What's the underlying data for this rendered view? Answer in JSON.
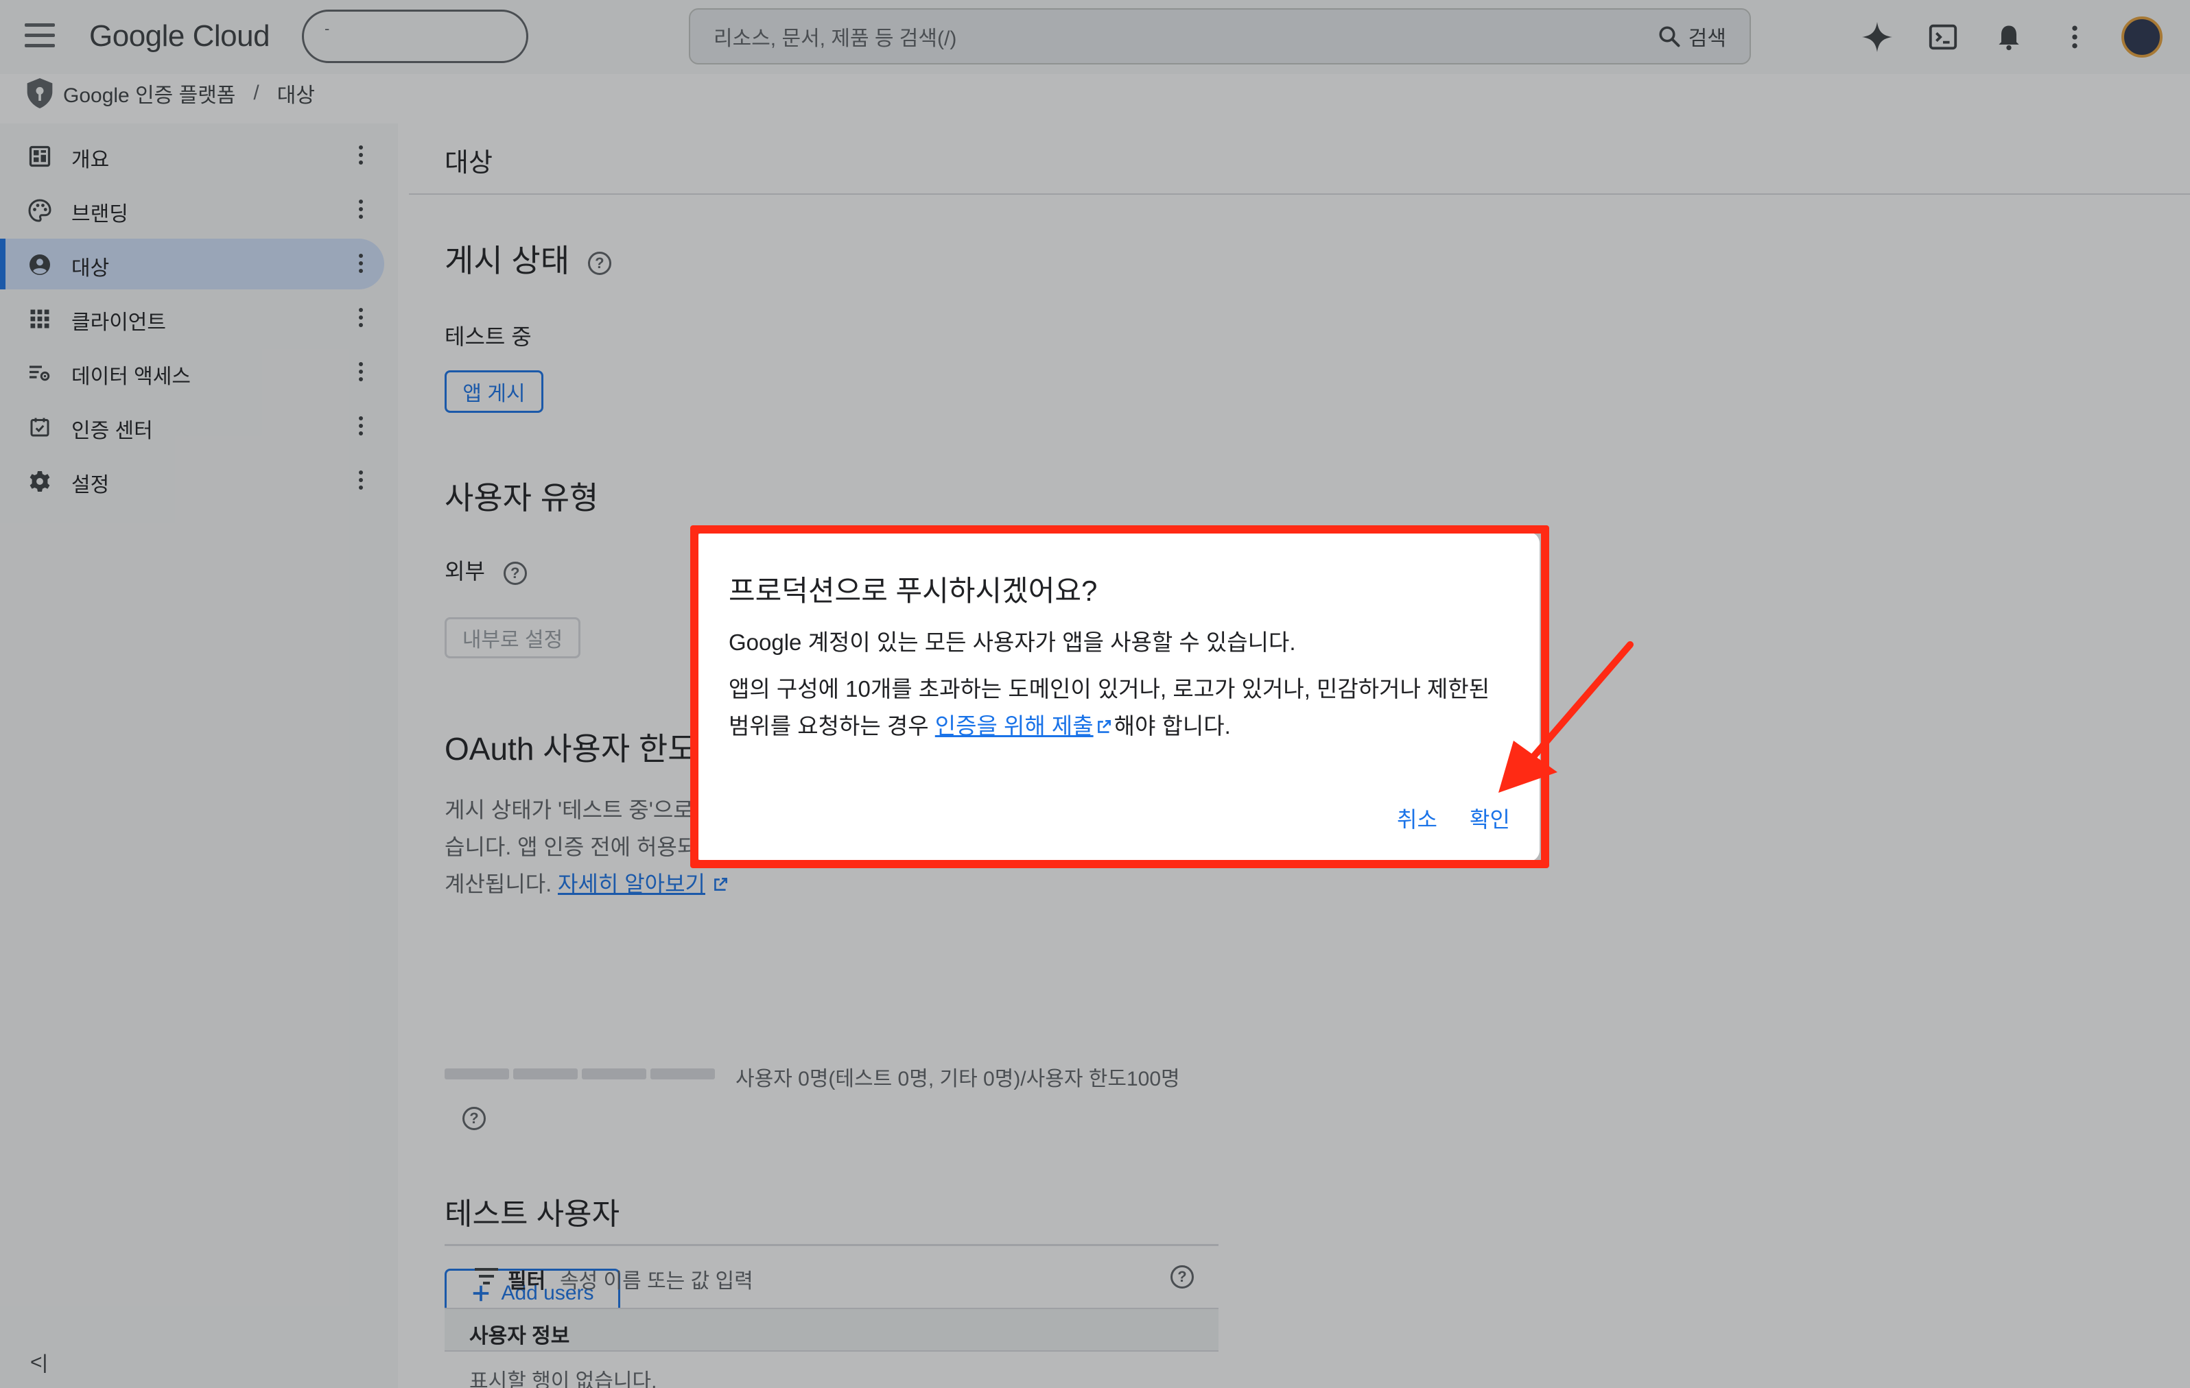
{
  "topbar": {
    "logo": "Google Cloud",
    "project_picker": "-",
    "search_placeholder": "리소스, 문서, 제품 등 검색(/)",
    "search_button": "검색"
  },
  "breadcrumb": {
    "product": "Google 인증 플랫폼",
    "separator": "/",
    "current": "대상"
  },
  "sidebar": {
    "items": [
      {
        "label": "개요",
        "icon": "dashboard-icon"
      },
      {
        "label": "브랜딩",
        "icon": "palette-icon"
      },
      {
        "label": "대상",
        "icon": "account-circle-icon",
        "active": true
      },
      {
        "label": "클라이언트",
        "icon": "apps-grid-icon"
      },
      {
        "label": "데이터 액세스",
        "icon": "data-access-icon"
      },
      {
        "label": "인증 센터",
        "icon": "verified-check-icon"
      },
      {
        "label": "설정",
        "icon": "gear-icon"
      }
    ],
    "collapse_label": "<|"
  },
  "main": {
    "page_title": "대상",
    "publish_status": {
      "heading": "게시 상태",
      "value": "테스트 중",
      "button": "앱 게시"
    },
    "user_type": {
      "heading": "사용자 유형",
      "value": "외부",
      "button": "내부로 설정"
    },
    "oauth_limit": {
      "heading": "OAuth 사용자 한도",
      "line1": "게시 상태가 '테스트 중'으로",
      "line2": "습니다. 앱 인증 전에 허용되",
      "line3": "계산됩니다.",
      "learn_more": "자세히 알아보기",
      "usage": "사용자 0명(테스트 0명, 기타 0명)/사용자 한도100명",
      "usage_fraction": 0
    },
    "test_users": {
      "heading": "테스트 사용자",
      "add_button": "Add users",
      "filter_label": "필터",
      "filter_placeholder": "속성 이름 또는 값 입력",
      "column_header": "사용자 정보",
      "empty_text": "표시할 행이 없습니다."
    }
  },
  "dialog": {
    "title": "프로덕션으로 푸시하시겠어요?",
    "paragraph1": "Google 계정이 있는 모든 사용자가 앱을 사용할 수 있습니다.",
    "paragraph2_line1": "앱의 구성에 10개를 초과하는 도메인이 있거나, 로고가 있거나, 민감하거나 제한된",
    "paragraph2_line2_prefix": "범위를 요청하는 경우 ",
    "paragraph2_link": "인증을 위해 제출",
    "paragraph2_suffix": "해야 합니다.",
    "cancel": "취소",
    "confirm": "확인"
  },
  "colors": {
    "accent": "#1a73e8",
    "annotation": "#ff2a14",
    "scrim": "rgba(32,33,36,0.32)"
  }
}
